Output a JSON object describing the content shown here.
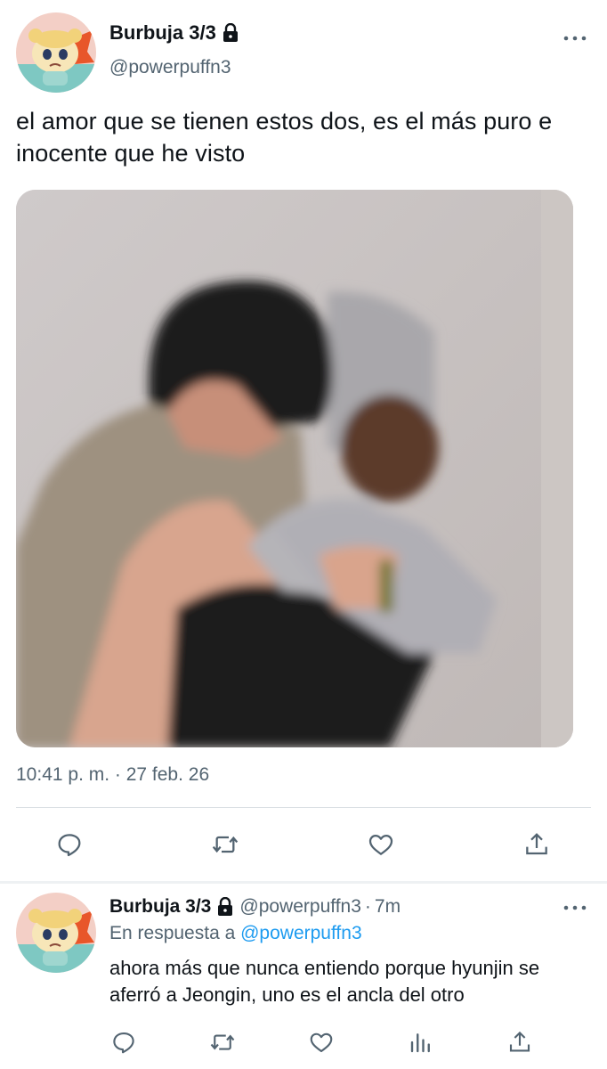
{
  "main_tweet": {
    "display_name": "Burbuja 3/3",
    "handle": "@powerpuffn3",
    "text": "el amor que se tienen estos dos, es el más puro e inocente que he visto",
    "timestamp": "10:41 p. m. · 27 feb. 26",
    "icons": {
      "lock": "lock-icon",
      "more": "more-icon",
      "actions": [
        "reply-icon",
        "retweet-icon",
        "like-icon",
        "share-icon"
      ]
    }
  },
  "reply_tweet": {
    "display_name": "Burbuja 3/3",
    "handle": "@powerpuffn3",
    "dot": "·",
    "time": "7m",
    "reply_prefix": "En respuesta a",
    "reply_mention": "@powerpuffn3",
    "text": "ahora más que nunca entiendo porque hyunjin se aferró a Jeongin, uno es el ancla del otro",
    "icons": [
      "reply-icon",
      "retweet-icon",
      "like-icon",
      "views-icon",
      "share-icon"
    ]
  },
  "colors": {
    "text": "#0f1419",
    "secondary": "#536471",
    "link": "#1d9bf0",
    "divider": "#d9dfe3"
  }
}
